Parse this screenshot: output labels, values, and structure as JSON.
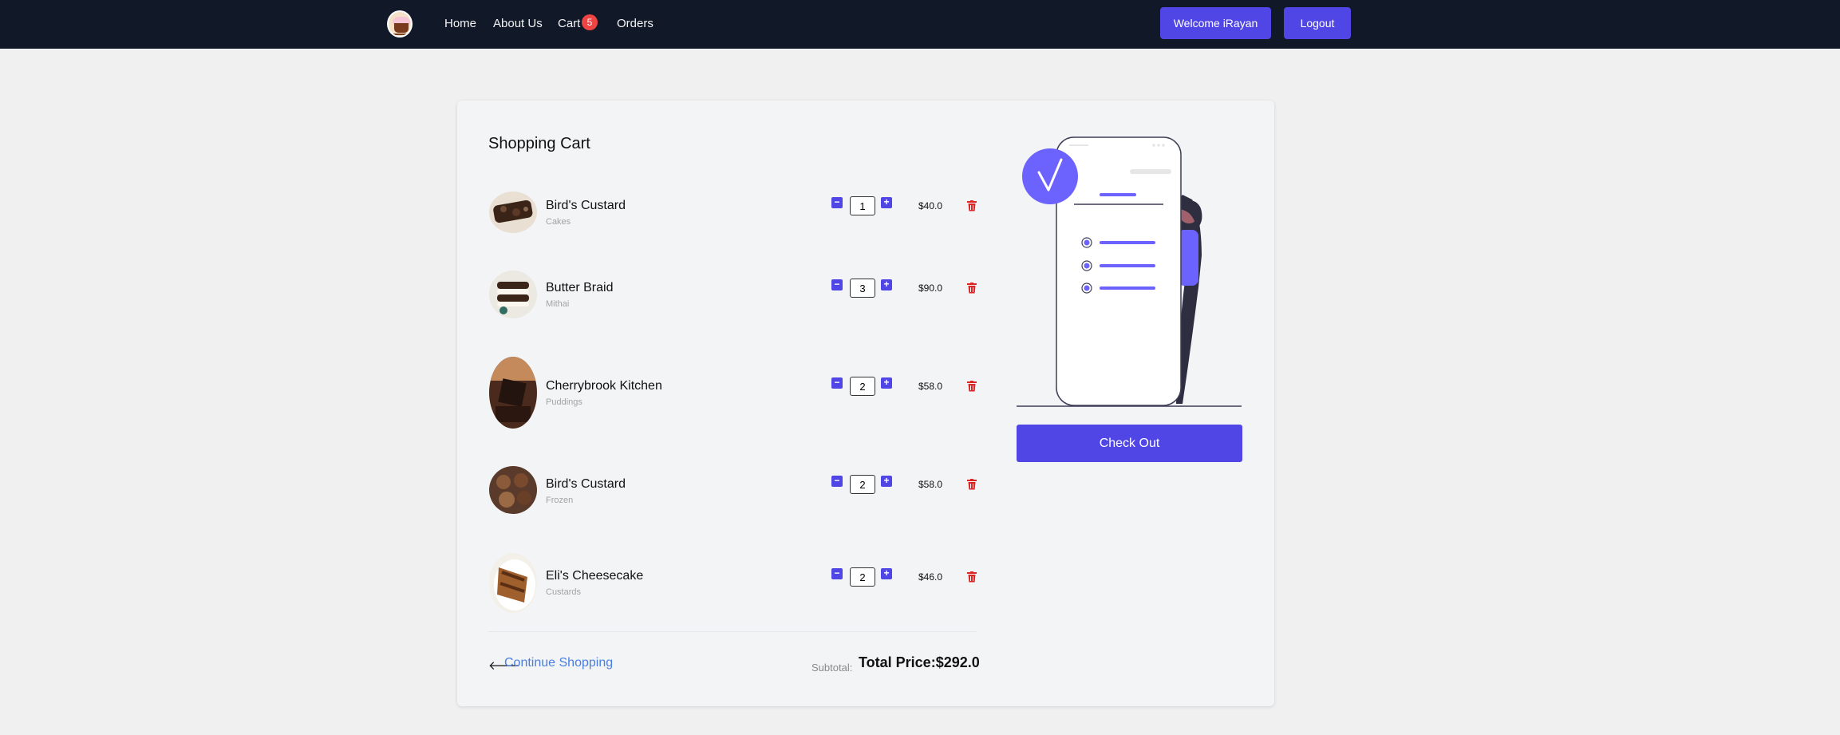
{
  "nav": {
    "home": "Home",
    "about": "About Us",
    "cart": "Cart",
    "cart_count": "5",
    "orders": "Orders",
    "welcome": "Welcome iRayan",
    "logout": "Logout"
  },
  "cart": {
    "title": "Shopping Cart",
    "items": [
      {
        "name": "Bird's Custard",
        "category": "Cakes",
        "quantity": "1",
        "price": "$40.0"
      },
      {
        "name": "Butter Braid",
        "category": "Mithai",
        "quantity": "3",
        "price": "$90.0"
      },
      {
        "name": "Cherrybrook Kitchen",
        "category": "Puddings",
        "quantity": "2",
        "price": "$58.0"
      },
      {
        "name": "Bird's Custard",
        "category": "Frozen",
        "quantity": "2",
        "price": "$58.0"
      },
      {
        "name": "Eli's Cheesecake",
        "category": "Custards",
        "quantity": "2",
        "price": "$46.0"
      }
    ],
    "continue_shopping": "Continue Shopping",
    "subtotal_label": "Subtotal:",
    "total_price": "Total Price:$292.0",
    "checkout": "Check Out"
  },
  "icons": {
    "minus": "−",
    "plus": "+",
    "arrow": "🡐"
  },
  "colors": {
    "navbar": "#111827",
    "accent": "#4f46e5",
    "badge": "#ef4444",
    "trash": "#dc2626",
    "link": "#4a7fe0"
  }
}
